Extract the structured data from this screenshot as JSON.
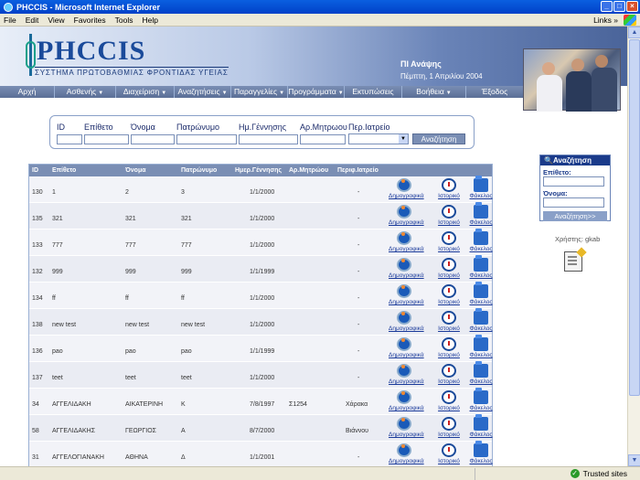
{
  "window": {
    "title": "PHCCIS - Microsoft Internet Explorer"
  },
  "menubar": {
    "items": [
      "File",
      "Edit",
      "View",
      "Favorites",
      "Tools",
      "Help"
    ],
    "links": "Links"
  },
  "header": {
    "logo": "PHCCIS",
    "subtitle": "ΣΥΣΤΗΜΑ ΠΡΩΤΟΒΑΘΜΙΑΣ ΦΡΟΝΤΙΔΑΣ ΥΓΕΙΑΣ",
    "place": "ΠΙ Ανάψης",
    "date": "Πέμπτη, 1 Απριλίου 2004"
  },
  "nav": [
    {
      "label": "Αρχή",
      "dropdown": false
    },
    {
      "label": "Ασθενής",
      "dropdown": true
    },
    {
      "label": "Διαχείριση",
      "dropdown": true
    },
    {
      "label": "Αναζητήσεις",
      "dropdown": true
    },
    {
      "label": "Παραγγελίες",
      "dropdown": true
    },
    {
      "label": "Προγράμματα",
      "dropdown": true
    },
    {
      "label": "Εκτυπώσεις",
      "dropdown": false
    },
    {
      "label": "Βοήθεια",
      "dropdown": true
    },
    {
      "label": "Έξοδος",
      "dropdown": false
    }
  ],
  "search": {
    "labels": [
      "ID",
      "Επίθετο",
      "Όνομα",
      "Πατρώνυμο",
      "Ημ.Γέννησης",
      "Αρ.Μητρωου",
      "Περ.Ιατρείο"
    ],
    "button": "Αναζήτηση"
  },
  "table": {
    "headers": [
      "ID",
      "Επίθετο",
      "Όνομα",
      "Πατρώνυμο",
      "Ημερ.Γέννησης",
      "Αρ.Μητρώου",
      "Περιφ.Ιατρείο"
    ],
    "link_labels": [
      "Δημογραφικά",
      "Ιστορικό",
      "Φάκελος"
    ],
    "rows": [
      {
        "id": "130",
        "surname": "1",
        "name": "2",
        "father": "3",
        "dob": "1/1/2000",
        "reg": "",
        "clinic": "-"
      },
      {
        "id": "135",
        "surname": "321",
        "name": "321",
        "father": "321",
        "dob": "1/1/2000",
        "reg": "",
        "clinic": "-"
      },
      {
        "id": "133",
        "surname": "777",
        "name": "777",
        "father": "777",
        "dob": "1/1/2000",
        "reg": "",
        "clinic": "-"
      },
      {
        "id": "132",
        "surname": "999",
        "name": "999",
        "father": "999",
        "dob": "1/1/1999",
        "reg": "",
        "clinic": "-"
      },
      {
        "id": "134",
        "surname": "ff",
        "name": "ff",
        "father": "ff",
        "dob": "1/1/2000",
        "reg": "",
        "clinic": "-"
      },
      {
        "id": "138",
        "surname": "new test",
        "name": "new test",
        "father": "new test",
        "dob": "1/1/2000",
        "reg": "",
        "clinic": "-"
      },
      {
        "id": "136",
        "surname": "pao",
        "name": "pao",
        "father": "pao",
        "dob": "1/1/1999",
        "reg": "",
        "clinic": "-"
      },
      {
        "id": "137",
        "surname": "teet",
        "name": "teet",
        "father": "teet",
        "dob": "1/1/2000",
        "reg": "",
        "clinic": "-"
      },
      {
        "id": "34",
        "surname": "ΑΓΓΕΛΙΔΑΚΗ",
        "name": "ΑΙΚΑΤΕΡΙΝΗ",
        "father": "Κ",
        "dob": "7/8/1997",
        "reg": "Σ1254",
        "clinic": "Χάρακα"
      },
      {
        "id": "58",
        "surname": "ΑΓΓΕΛΙΔΑΚΗΣ",
        "name": "ΓΕΩΡΓΙΟΣ",
        "father": "Α",
        "dob": "8/7/2000",
        "reg": "",
        "clinic": "Βιάννου"
      },
      {
        "id": "31",
        "surname": "ΑΓΓΕΛΟΓΙΑΝΑΚΗ",
        "name": "ΑΘΗΝΑ",
        "father": "Δ",
        "dob": "1/1/2001",
        "reg": "",
        "clinic": "-"
      }
    ]
  },
  "side": {
    "title": "Αναζήτηση",
    "surname_label": "Επίθετο:",
    "name_label": "Όνομα:",
    "button": "Αναζήτηση>>",
    "user": "Χρήστης: gkab"
  },
  "status": {
    "zone": "Trusted sites"
  }
}
